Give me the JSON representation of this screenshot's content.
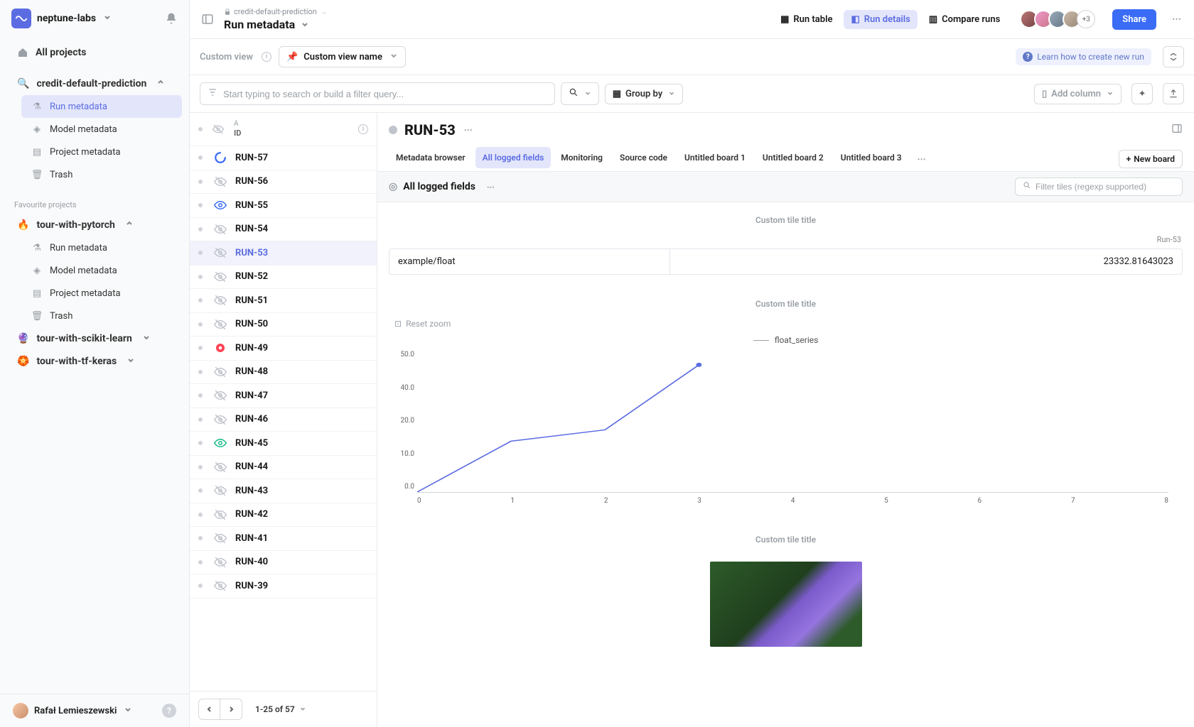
{
  "workspace": "neptune-labs",
  "sidebar": {
    "all_projects": "All projects",
    "project1": {
      "name": "credit-default-prediction",
      "emoji": "🔍",
      "items": [
        "Run metadata",
        "Model metadata",
        "Project metadata",
        "Trash"
      ]
    },
    "fav_header": "Favourite projects",
    "project2": {
      "name": "tour-with-pytorch",
      "emoji": "🔥",
      "items": [
        "Run metadata",
        "Model metadata",
        "Project metadata",
        "Trash"
      ]
    },
    "project3": {
      "name": "tour-with-scikit-learn",
      "emoji": "🔮"
    },
    "project4": {
      "name": "tour-with-tf-keras",
      "emoji": "🏵️"
    },
    "user": "Rafał Lemieszewski"
  },
  "topbar": {
    "breadcrumb": "credit-default-prediction",
    "title": "Run metadata",
    "tabs": {
      "table": "Run table",
      "details": "Run details",
      "compare": "Compare runs"
    },
    "avatar_more": "+3",
    "share": "Share"
  },
  "toolbar2": {
    "custom_view": "Custom view",
    "custom_view_name": "Custom view name",
    "learn": "Learn how to create new run"
  },
  "toolbar3": {
    "search_placeholder": "Start typing to search or build a filter query...",
    "group_by": "Group by",
    "add_column": "Add column"
  },
  "runs_head": {
    "letter": "A",
    "id": "ID"
  },
  "runs": [
    {
      "id": "RUN-57",
      "status": "loading"
    },
    {
      "id": "RUN-56",
      "status": "hidden"
    },
    {
      "id": "RUN-55",
      "status": "visible"
    },
    {
      "id": "RUN-54",
      "status": "hidden"
    },
    {
      "id": "RUN-53",
      "status": "hidden",
      "selected": true
    },
    {
      "id": "RUN-52",
      "status": "hidden"
    },
    {
      "id": "RUN-51",
      "status": "hidden"
    },
    {
      "id": "RUN-50",
      "status": "hidden"
    },
    {
      "id": "RUN-49",
      "status": "alert"
    },
    {
      "id": "RUN-48",
      "status": "hidden"
    },
    {
      "id": "RUN-47",
      "status": "hidden"
    },
    {
      "id": "RUN-46",
      "status": "hidden"
    },
    {
      "id": "RUN-45",
      "status": "visible-green"
    },
    {
      "id": "RUN-44",
      "status": "hidden"
    },
    {
      "id": "RUN-43",
      "status": "hidden"
    },
    {
      "id": "RUN-42",
      "status": "hidden"
    },
    {
      "id": "RUN-41",
      "status": "hidden"
    },
    {
      "id": "RUN-40",
      "status": "hidden"
    },
    {
      "id": "RUN-39",
      "status": "hidden"
    }
  ],
  "pagination": "1-25 of 57",
  "detail": {
    "title": "RUN-53",
    "tabs": [
      "Metadata browser",
      "All logged fields",
      "Monitoring",
      "Source code",
      "Untitled board 1",
      "Untitled board 2",
      "Untitled board 3"
    ],
    "active_tab": 1,
    "new_board": "New board",
    "section_title": "All logged fields",
    "filter_placeholder": "Filter tiles (regexp supported)",
    "tile_title": "Custom tile title",
    "tile1_legend": "Run-53",
    "kv_key": "example/float",
    "kv_val": "23332.81643023",
    "reset_zoom": "Reset zoom",
    "series_name": "float_series"
  },
  "chart_data": {
    "type": "line",
    "title": "Custom tile title",
    "series_name": "float_series",
    "x": [
      0,
      1,
      2,
      3
    ],
    "values": [
      0,
      18,
      22,
      45
    ],
    "xlabel": "",
    "ylabel": "",
    "xlim": [
      0,
      8
    ],
    "ylim": [
      0,
      50
    ],
    "xticks": [
      0,
      1,
      2,
      3,
      4,
      5,
      6,
      7,
      8
    ],
    "yticks": [
      0.0,
      10.0,
      20.0,
      40.0,
      50.0
    ]
  }
}
